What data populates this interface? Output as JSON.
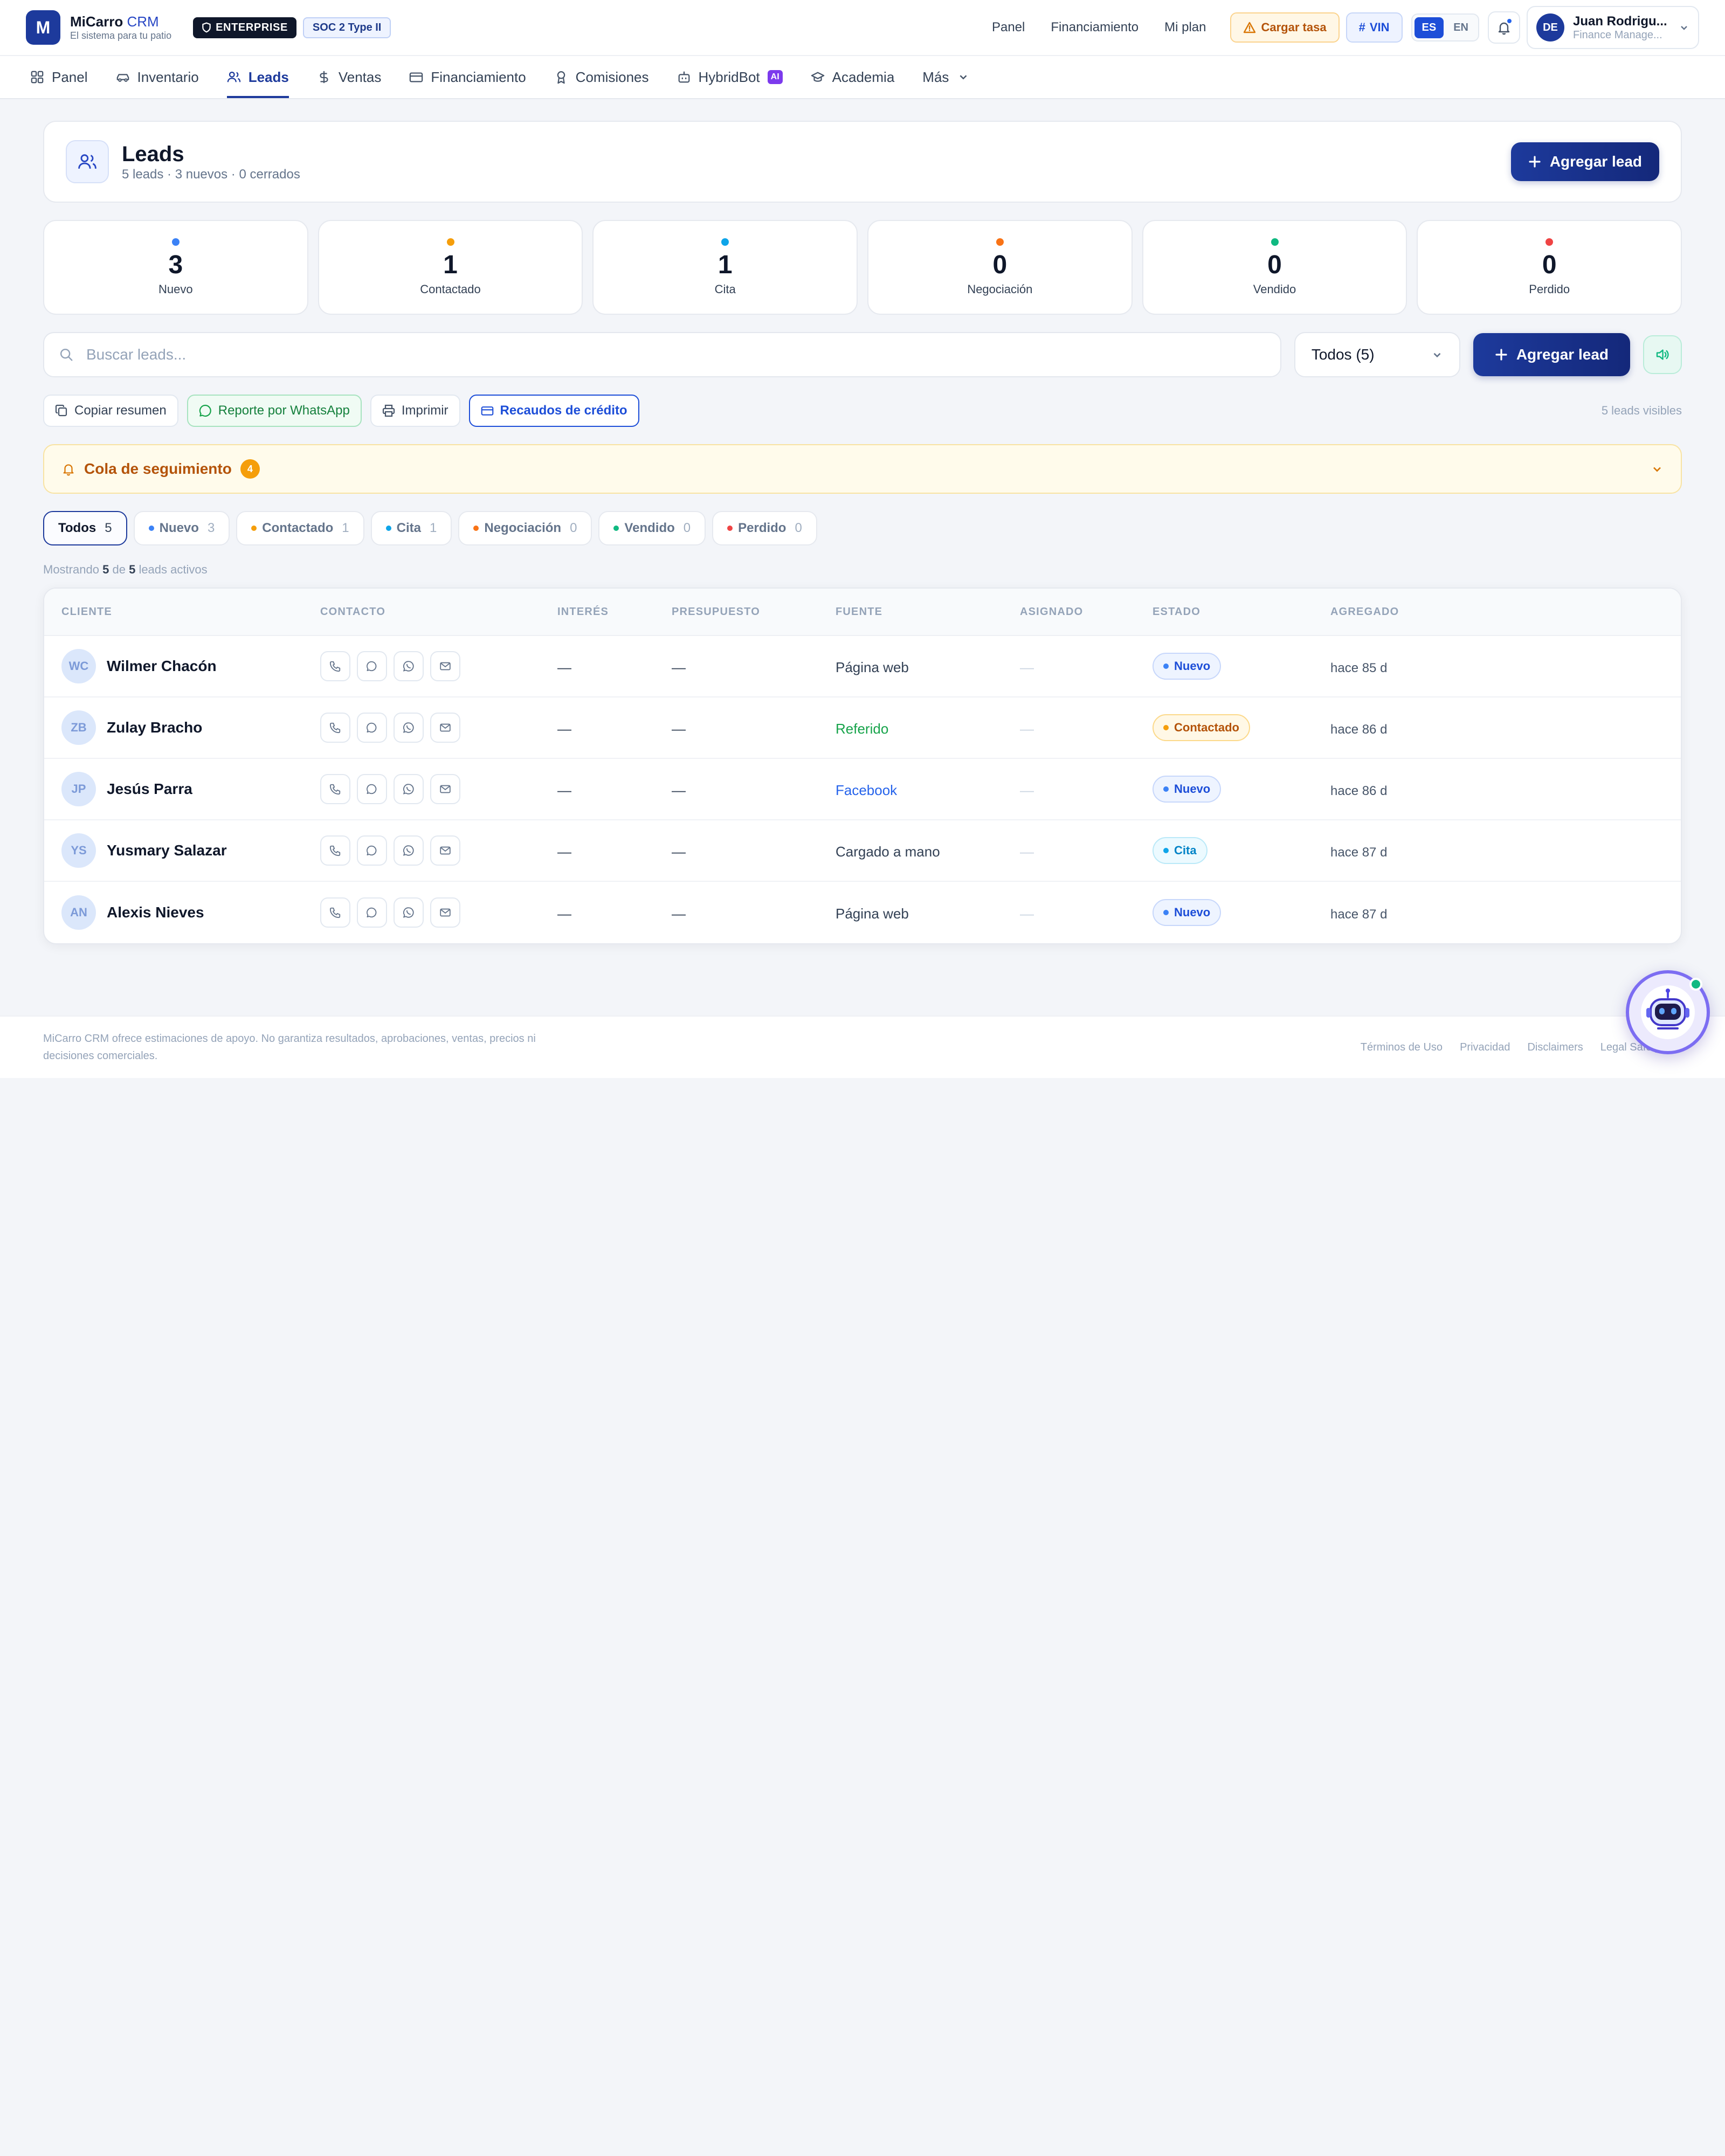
{
  "header": {
    "logo_letter": "M",
    "brand": "MiCarro",
    "brand_crm": "CRM",
    "tagline": "El sistema para tu patio",
    "badge_enterprise": "ENTERPRISE",
    "badge_soc": "SOC 2 Type II",
    "links": [
      "Panel",
      "Financiamiento",
      "Mi plan"
    ],
    "cargar_tasa": "Cargar tasa",
    "vin": "VIN",
    "lang_es": "ES",
    "lang_en": "EN",
    "user_initials": "DE",
    "user_name": "Juan Rodrigu...",
    "user_role": "Finance Manage..."
  },
  "nav": {
    "tabs": [
      {
        "label": "Panel",
        "icon": "grid-icon"
      },
      {
        "label": "Inventario",
        "icon": "car-icon"
      },
      {
        "label": "Leads",
        "icon": "users-icon",
        "active": true
      },
      {
        "label": "Ventas",
        "icon": "dollar-icon"
      },
      {
        "label": "Financiamiento",
        "icon": "card-icon"
      },
      {
        "label": "Comisiones",
        "icon": "award-icon"
      },
      {
        "label": "HybridBot",
        "icon": "bot-icon",
        "chip": "AI"
      },
      {
        "label": "Academia",
        "icon": "graduation-icon"
      },
      {
        "label": "Más",
        "icon": "chevron-down-icon"
      }
    ]
  },
  "page": {
    "title": "Leads",
    "subtitle": "5 leads · 3 nuevos · 0 cerrados",
    "add_lead": "Agregar lead"
  },
  "stats": [
    {
      "value": "3",
      "label": "Nuevo",
      "color": "#3b82f6"
    },
    {
      "value": "1",
      "label": "Contactado",
      "color": "#f59e0b"
    },
    {
      "value": "1",
      "label": "Cita",
      "color": "#0ea5e9"
    },
    {
      "value": "0",
      "label": "Negociación",
      "color": "#f97316"
    },
    {
      "value": "0",
      "label": "Vendido",
      "color": "#10b981"
    },
    {
      "value": "0",
      "label": "Perdido",
      "color": "#ef4444"
    }
  ],
  "search": {
    "placeholder": "Buscar leads...",
    "filter_value": "Todos (5)",
    "add_lead": "Agregar lead"
  },
  "actions": {
    "copy": "Copiar resumen",
    "whatsapp": "Reporte por WhatsApp",
    "print": "Imprimir",
    "credit": "Recaudos de crédito",
    "visible": "5 leads visibles"
  },
  "queue": {
    "title": "Cola de seguimiento",
    "count": "4"
  },
  "pills": [
    {
      "label": "Todos",
      "count": "5",
      "active": true,
      "color": ""
    },
    {
      "label": "Nuevo",
      "count": "3",
      "color": "#3b82f6"
    },
    {
      "label": "Contactado",
      "count": "1",
      "color": "#f59e0b"
    },
    {
      "label": "Cita",
      "count": "1",
      "color": "#0ea5e9"
    },
    {
      "label": "Negociación",
      "count": "0",
      "color": "#f97316"
    },
    {
      "label": "Vendido",
      "count": "0",
      "color": "#10b981"
    },
    {
      "label": "Perdido",
      "count": "0",
      "color": "#ef4444"
    }
  ],
  "showing": {
    "prefix": "Mostrando",
    "shown": "5",
    "of": "de",
    "total": "5",
    "suffix": "leads activos"
  },
  "table": {
    "columns": [
      "CLIENTE",
      "CONTACTO",
      "INTERÉS",
      "PRESUPUESTO",
      "FUENTE",
      "ASIGNADO",
      "ESTADO",
      "AGREGADO"
    ],
    "rows": [
      {
        "initials": "WC",
        "name": "Wilmer Chacón",
        "interest": "—",
        "budget": "—",
        "source": "Página web",
        "source_color": "#334155",
        "assigned": "—",
        "status": "Nuevo",
        "status_kind": "nuevo",
        "added": "hace 85 d"
      },
      {
        "initials": "ZB",
        "name": "Zulay Bracho",
        "interest": "—",
        "budget": "—",
        "source": "Referido",
        "source_color": "#16a34a",
        "assigned": "—",
        "status": "Contactado",
        "status_kind": "contactado",
        "added": "hace 86 d"
      },
      {
        "initials": "JP",
        "name": "Jesús Parra",
        "interest": "—",
        "budget": "—",
        "source": "Facebook",
        "source_color": "#2563eb",
        "assigned": "—",
        "status": "Nuevo",
        "status_kind": "nuevo",
        "added": "hace 86 d"
      },
      {
        "initials": "YS",
        "name": "Yusmary Salazar",
        "interest": "—",
        "budget": "—",
        "source": "Cargado a mano",
        "source_color": "#334155",
        "assigned": "—",
        "status": "Cita",
        "status_kind": "cita",
        "added": "hace 87 d"
      },
      {
        "initials": "AN",
        "name": "Alexis Nieves",
        "interest": "—",
        "budget": "—",
        "source": "Página web",
        "source_color": "#334155",
        "assigned": "—",
        "status": "Nuevo",
        "status_kind": "nuevo",
        "added": "hace 87 d"
      }
    ]
  },
  "status_styles": {
    "nuevo": {
      "bg": "#eef4ff",
      "border": "#c7d7fb",
      "text": "#1d4ed8",
      "dot": "#3b82f6"
    },
    "contactado": {
      "bg": "#fff8e6",
      "border": "#fcd98a",
      "text": "#b45309",
      "dot": "#f59e0b"
    },
    "cita": {
      "bg": "#ecfaff",
      "border": "#bae9f8",
      "text": "#0284c7",
      "dot": "#0ea5e9"
    }
  },
  "footer": {
    "note": "MiCarro CRM ofrece estimaciones de apoyo. No garantiza resultados, aprobaciones, ventas, precios ni decisiones comerciales.",
    "links": [
      "Términos de Uso",
      "Privacidad",
      "Disclaimers",
      "Legal Safety"
    ]
  }
}
